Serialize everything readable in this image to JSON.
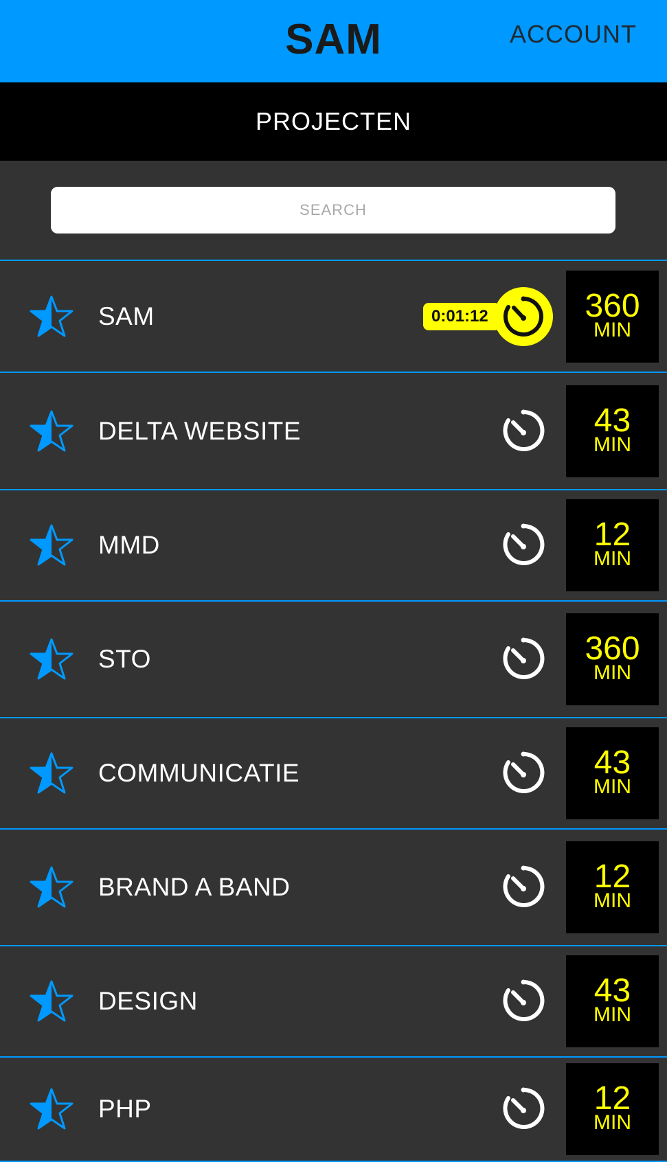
{
  "header": {
    "title": "SAM",
    "account_label": "ACCOUNT",
    "background_color": "#0099ff"
  },
  "subheader": {
    "title": "PROJECTEN"
  },
  "search": {
    "placeholder": "SEARCH",
    "value": ""
  },
  "colors": {
    "accent": "#0099ff",
    "highlight": "#ffff00",
    "row_background": "#333333"
  },
  "projects": [
    {
      "name": "SAM",
      "minutes": "360",
      "unit": "MIN",
      "timer_running": true,
      "timer_text": "0:01:12",
      "favorite_icon": "star-icon",
      "timer_icon": "stopwatch-icon"
    },
    {
      "name": "DELTA WEBSITE",
      "minutes": "43",
      "unit": "MIN",
      "timer_running": false,
      "favorite_icon": "star-icon",
      "timer_icon": "stopwatch-icon"
    },
    {
      "name": "MMD",
      "minutes": "12",
      "unit": "MIN",
      "timer_running": false,
      "favorite_icon": "star-icon",
      "timer_icon": "stopwatch-icon"
    },
    {
      "name": "STO",
      "minutes": "360",
      "unit": "MIN",
      "timer_running": false,
      "favorite_icon": "star-icon",
      "timer_icon": "stopwatch-icon"
    },
    {
      "name": "COMMUNICATIE",
      "minutes": "43",
      "unit": "MIN",
      "timer_running": false,
      "favorite_icon": "star-icon",
      "timer_icon": "stopwatch-icon"
    },
    {
      "name": "BRAND A BAND",
      "minutes": "12",
      "unit": "MIN",
      "timer_running": false,
      "favorite_icon": "star-icon",
      "timer_icon": "stopwatch-icon"
    },
    {
      "name": "DESIGN",
      "minutes": "43",
      "unit": "MIN",
      "timer_running": false,
      "favorite_icon": "star-icon",
      "timer_icon": "stopwatch-icon"
    },
    {
      "name": "PHP",
      "minutes": "12",
      "unit": "MIN",
      "timer_running": false,
      "favorite_icon": "star-icon",
      "timer_icon": "stopwatch-icon"
    }
  ]
}
